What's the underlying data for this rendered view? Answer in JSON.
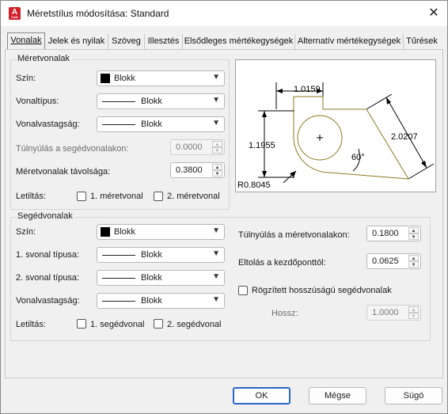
{
  "window": {
    "title": "Méretstílus módosítása: Standard",
    "app_icon_letter": "A",
    "app_icon_sub": "CAD"
  },
  "tabs": [
    {
      "label": "Vonalak"
    },
    {
      "label": "Jelek és nyilak"
    },
    {
      "label": "Szöveg"
    },
    {
      "label": "Illesztés"
    },
    {
      "label": "Elsődleges mértékegységek"
    },
    {
      "label": "Alternatív mértékegységek"
    },
    {
      "label": "Tűrések"
    }
  ],
  "dim_lines": {
    "group_label": "Méretvonalak",
    "color_label": "Szín:",
    "color_value": "Blokk",
    "linetype_label": "Vonaltípus:",
    "linetype_value": "Blokk",
    "lineweight_label": "Vonalvastagság:",
    "lineweight_value": "Blokk",
    "extend_label": "Túlnyúlás a segédvonalakon:",
    "extend_value": "0.0000",
    "spacing_label": "Méretvonalak távolsága:",
    "spacing_value": "0.3800",
    "suppress_label": "Letiltás:",
    "suppress_1": "1. méretvonal",
    "suppress_2": "2. méretvonal"
  },
  "ext_lines": {
    "group_label": "Segédvonalak",
    "color_label": "Szín:",
    "color_value": "Blokk",
    "linetype1_label": "1. svonal típusa:",
    "linetype1_value": "Blokk",
    "linetype2_label": "2. svonal típusa:",
    "linetype2_value": "Blokk",
    "lineweight_label": "Vonalvastagság:",
    "lineweight_value": "Blokk",
    "suppress_label": "Letiltás:",
    "suppress_1": "1. segédvonal",
    "suppress_2": "2. segédvonal",
    "extend_label": "Túlnyúlás a méretvonalakon:",
    "extend_value": "0.1800",
    "offset_label": "Eltolás a kezdőponttól:",
    "offset_value": "0.0625",
    "fixed_label": "Rögzített hosszúságú segédvonalak",
    "length_label": "Hossz:",
    "length_value": "1.0000"
  },
  "preview": {
    "dim_top": "1.0159",
    "dim_left": "1.1955",
    "dim_right": "2.0207",
    "angle": "60°",
    "radius": "R0.8045"
  },
  "buttons": {
    "ok": "OK",
    "cancel": "Mégse",
    "help": "Súgó"
  },
  "colors": {
    "accent": "#2c67c9",
    "outline": "#8a7a20"
  }
}
